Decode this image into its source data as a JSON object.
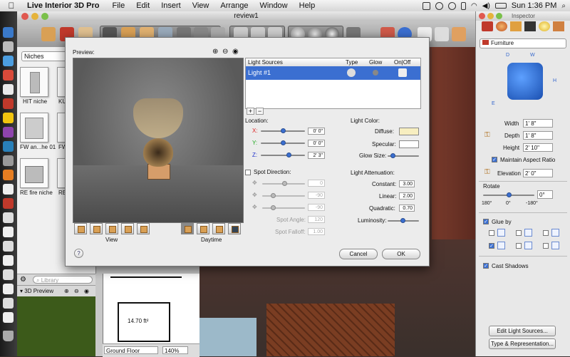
{
  "menubar": {
    "app_name": "Live Interior 3D Pro",
    "items": [
      "File",
      "Edit",
      "Insert",
      "View",
      "Arrange",
      "Window",
      "Help"
    ],
    "clock": "Sun 1:36 PM"
  },
  "window": {
    "title": "review1"
  },
  "catalog": {
    "category": "Niches",
    "search_placeholder": "Library",
    "items": [
      {
        "label": "HIT niche"
      },
      {
        "label": "KU"
      },
      {
        "label": "FW an...he 01"
      },
      {
        "label": "FW"
      },
      {
        "label": "RE fire niche"
      },
      {
        "label": "RE"
      }
    ]
  },
  "panel3d": {
    "label": "3D Preview"
  },
  "plan": {
    "area_label": "14.70 ft²",
    "floor_select": "Ground Floor",
    "zoom": "140%"
  },
  "dialog": {
    "preview_label": "Preview:",
    "view_label": "View",
    "daytime_label": "Daytime",
    "table_headers": {
      "sources": "Light Sources",
      "type": "Type",
      "glow": "Glow",
      "onoff": "On|Off"
    },
    "lights": [
      {
        "name": "Light #1"
      }
    ],
    "add": "+",
    "remove": "−",
    "location": {
      "label": "Location:",
      "x_label": "X:",
      "x": "0' 0\"",
      "y_label": "Y:",
      "y": "0' 0\"",
      "z_label": "Z:",
      "z": "2' 3\""
    },
    "spot": {
      "label": "Spot Direction:",
      "v1": "0",
      "v2": "-90",
      "v3": "-90",
      "angle_label": "Spot Angle:",
      "angle": "120",
      "falloff_label": "Spot Falloff:",
      "falloff": "1.00"
    },
    "color": {
      "label": "Light Color:",
      "diffuse_label": "Diffuse:",
      "diffuse_color": "#f7eec0",
      "specular_label": "Specular:",
      "specular_color": "#ffffff",
      "glow_label": "Glow Size:"
    },
    "attenuation": {
      "label": "Light Attenuation:",
      "constant_label": "Constant:",
      "constant": "3.00",
      "linear_label": "Linear:",
      "linear": "2.00",
      "quadratic_label": "Quadratic:",
      "quadratic": "0.70",
      "luminosity_label": "Luminosity:"
    },
    "help": "?",
    "cancel": "Cancel",
    "ok": "OK"
  },
  "inspector": {
    "title": "Inspector",
    "category": "Furniture",
    "dims": {
      "d": "D",
      "w": "W",
      "h": "H",
      "e": "E"
    },
    "width_label": "Width",
    "width": "1' 8\"",
    "depth_label": "Depth",
    "depth": "1' 8\"",
    "height_label": "Height",
    "height": "2' 10\"",
    "aspect_label": "Maintain Aspect Ratio",
    "elevation_label": "Elevation",
    "elevation": "2' 0\"",
    "rotate_label": "Rotate",
    "rotate": "0°",
    "rotate_ticks": [
      "180°",
      "0°",
      "-180°"
    ],
    "glue_label": "Glue by",
    "shadows_label": "Cast Shadows",
    "edit_lights": "Edit Light Sources...",
    "type_rep": "Type & Representation..."
  },
  "colors": {
    "accent": "#3b6fd1",
    "lamp": "#c9a064"
  }
}
